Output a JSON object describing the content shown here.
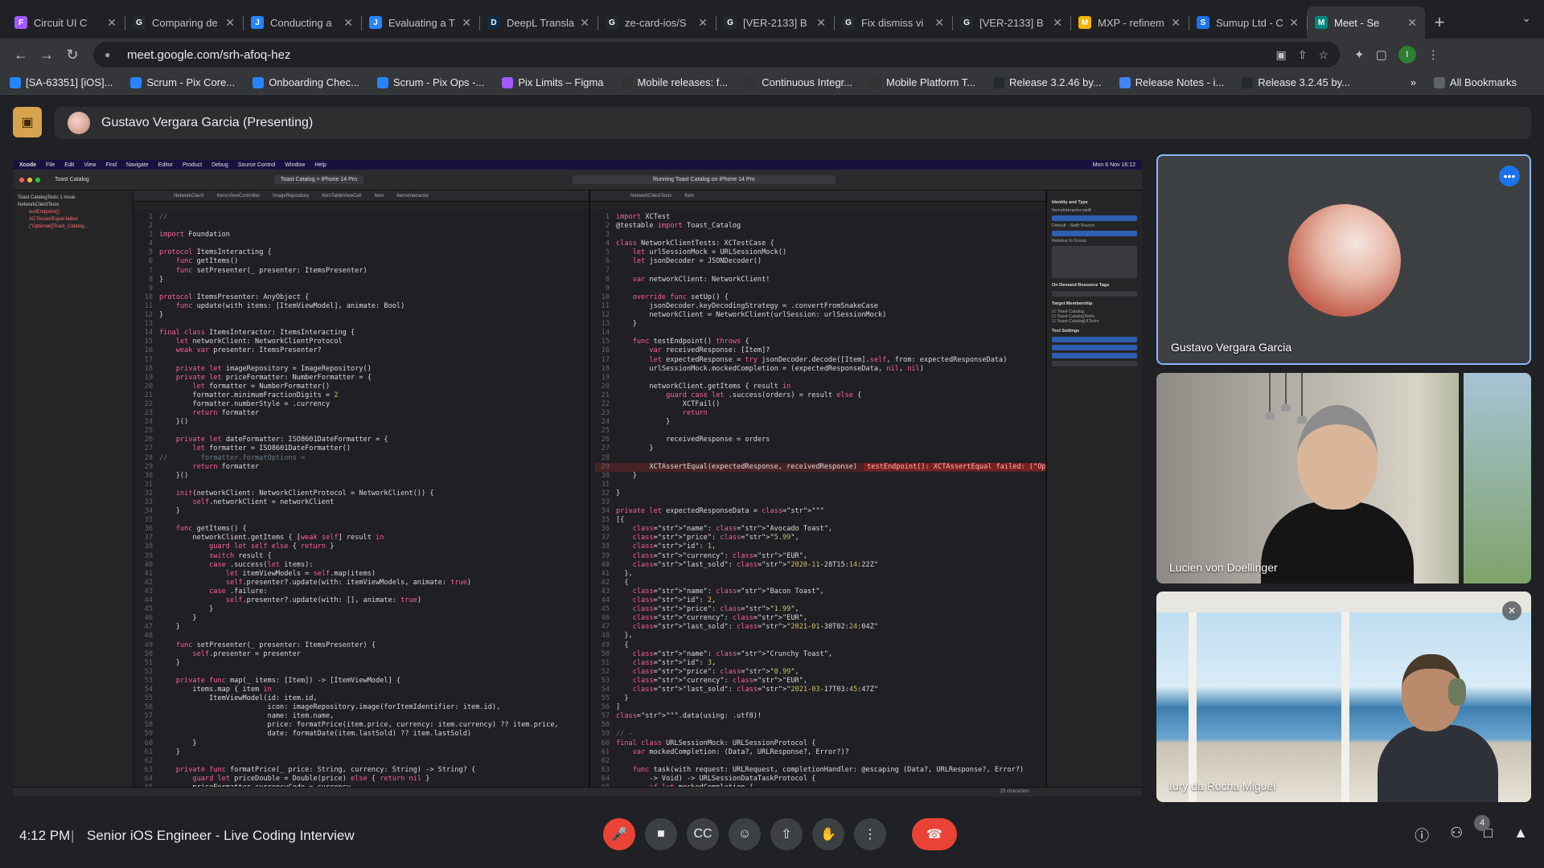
{
  "browser": {
    "tabs": [
      {
        "title": "Circuit UI C",
        "fav": "F",
        "color": "#a259ff"
      },
      {
        "title": "Comparing de",
        "fav": "G",
        "color": "#24292e"
      },
      {
        "title": "Conducting a",
        "fav": "J",
        "color": "#2684ff"
      },
      {
        "title": "Evaluating a T",
        "fav": "J",
        "color": "#2684ff"
      },
      {
        "title": "DeepL Transla",
        "fav": "D",
        "color": "#0f2b46"
      },
      {
        "title": "ze-card-ios/S",
        "fav": "G",
        "color": "#24292e"
      },
      {
        "title": "[VER-2133] B",
        "fav": "G",
        "color": "#24292e"
      },
      {
        "title": "Fix dismiss vi",
        "fav": "G",
        "color": "#24292e"
      },
      {
        "title": "[VER-2133] B",
        "fav": "G",
        "color": "#24292e"
      },
      {
        "title": "MXP - refinem",
        "fav": "M",
        "color": "#f4b400"
      },
      {
        "title": "Sumup Ltd - C",
        "fav": "S",
        "color": "#1a73e8"
      },
      {
        "title": "Meet - Se",
        "fav": "M",
        "color": "#00897b",
        "active": true
      }
    ],
    "url": "meet.google.com/srh-afoq-hez",
    "profile_initial": "I",
    "bookmarks": [
      {
        "label": "[SA-63351] [iOS]...",
        "color": "#2684ff"
      },
      {
        "label": "Scrum - Pix Core...",
        "color": "#2684ff"
      },
      {
        "label": "Onboarding Chec...",
        "color": "#2684ff"
      },
      {
        "label": "Scrum - Pix Ops -...",
        "color": "#2684ff"
      },
      {
        "label": "Pix Limits – Figma",
        "color": "#a259ff"
      },
      {
        "label": "Mobile releases: f...",
        "color": "#333333"
      },
      {
        "label": "Continuous Integr...",
        "color": "#333333"
      },
      {
        "label": "Mobile Platform T...",
        "color": "#333333"
      },
      {
        "label": "Release 3.2.46 by...",
        "color": "#24292e"
      },
      {
        "label": "Release Notes - i...",
        "color": "#4285f4"
      },
      {
        "label": "Release 3.2.45 by...",
        "color": "#24292e"
      }
    ],
    "all_bookmarks": "All Bookmarks",
    "more": "»"
  },
  "meet": {
    "presenting_label": "Gustavo Vergara Garcia (Presenting)",
    "participants": [
      {
        "name": "Gustavo Vergara Garcia"
      },
      {
        "name": "Lucien von Doellinger"
      },
      {
        "name": "Iury da Rocha Miguel"
      }
    ],
    "time": "4:12 PM",
    "separator": "|",
    "meeting_title": "Senior iOS Engineer - Live Coding Interview",
    "participant_count": "4"
  },
  "xcode": {
    "menubar": [
      "Xcode",
      "File",
      "Edit",
      "View",
      "Find",
      "Navigate",
      "Editor",
      "Product",
      "Debug",
      "Source Control",
      "Window",
      "Help"
    ],
    "datetime": "Mon 6 Nov 16:12",
    "project": "Toast Catalog",
    "scheme": "Toast Catalog > iPhone 14 Pro",
    "status": "Running Toast Catalog on iPhone 14 Pro",
    "navigator": [
      "Toast CatalogTests 1 issue",
      "NetworkClientTests",
      "testEndpoint():",
      "XCTAssertEqual failed:",
      "(\"Optional([Toast_Catalog..."
    ],
    "left_tabs": [
      "NetworkClient",
      "ItemsViewController",
      "ImageRepository",
      "ItemTableViewCell",
      "Item",
      "ItemsInteractor"
    ],
    "right_tabs": [
      "NetworkClientTests",
      "Item"
    ],
    "left_code": [
      "//",
      "",
      "import Foundation",
      "",
      "protocol ItemsInteracting {",
      "    func getItems()",
      "    func setPresenter(_ presenter: ItemsPresenter)",
      "}",
      "",
      "protocol ItemsPresenter: AnyObject {",
      "    func update(with items: [ItemViewModel], animate: Bool)",
      "}",
      "",
      "final class ItemsInteractor: ItemsInteracting {",
      "    let networkClient: NetworkClientProtocol",
      "    weak var presenter: ItemsPresenter?",
      "",
      "    private let imageRepository = ImageRepository()",
      "    private let priceFormatter: NumberFormatter = {",
      "        let formatter = NumberFormatter()",
      "        formatter.minimumFractionDigits = 2",
      "        formatter.numberStyle = .currency",
      "        return formatter",
      "    }()",
      "",
      "    private let dateFormatter: ISO8601DateFormatter = {",
      "        let formatter = ISO8601DateFormatter()",
      "//        formatter.formatOptions =",
      "        return formatter",
      "    }()",
      "",
      "    init(networkClient: NetworkClientProtocol = NetworkClient()) {",
      "        self.networkClient = networkClient",
      "    }",
      "",
      "    func getItems() {",
      "        networkClient.getItems { [weak self] result in",
      "            guard let self else { return }",
      "            switch result {",
      "            case .success(let items):",
      "                let itemViewModels = self.map(items)",
      "                self.presenter?.update(with: itemViewModels, animate: true)",
      "            case .failure:",
      "                self.presenter?.update(with: [], animate: true)",
      "            }",
      "        }",
      "    }",
      "",
      "    func setPresenter(_ presenter: ItemsPresenter) {",
      "        self.presenter = presenter",
      "    }",
      "",
      "    private func map(_ items: [Item]) -> [ItemViewModel] {",
      "        items.map { item in",
      "            ItemViewModel(id: item.id,",
      "                          icon: imageRepository.image(forItemIdentifier: item.id),",
      "                          name: item.name,",
      "                          price: formatPrice(item.price, currency: item.currency) ?? item.price,",
      "                          date: formatDate(item.lastSold) ?? item.lastSold)",
      "        }",
      "    }",
      "",
      "    private func formatPrice(_ price: String, currency: String) -> String? {",
      "        guard let priceDouble = Double(price) else { return nil }",
      "        priceFormatter.currencyCode = currency"
    ],
    "right_code": [
      "import XCTest",
      "@testable import Toast_Catalog",
      "",
      "class NetworkClientTests: XCTestCase {",
      "    let urlSessionMock = URLSessionMock()",
      "    let jsonDecoder = JSONDecoder()",
      "",
      "    var networkClient: NetworkClient!",
      "",
      "    override func setUp() {",
      "        jsonDecoder.keyDecodingStrategy = .convertFromSnakeCase",
      "        networkClient = NetworkClient(urlSession: urlSessionMock)",
      "    }",
      "",
      "    func testEndpoint() throws {",
      "        var receivedResponse: [Item]?",
      "        let expectedResponse = try jsonDecoder.decode([Item].self, from: expectedResponseData)",
      "        urlSessionMock.mockedCompletion = (expectedResponseData, nil, nil)",
      "",
      "        networkClient.getItems { result in",
      "            guard case let .success(orders) = result else {",
      "                XCTFail()",
      "                return",
      "            }",
      "",
      "            receivedResponse = orders",
      "        }",
      "",
      "        XCTAssertEqual(expectedResponse, receivedResponse)",
      "    }",
      "",
      "}",
      "",
      "private let expectedResponseData = \"\"\"",
      "[{",
      "    \"name\": \"Avocado Toast\",",
      "    \"price\": \"5.99\",",
      "    \"id\": 1,",
      "    \"currency\": \"EUR\",",
      "    \"last_sold\": \"2020-11-28T15:14:22Z\"",
      "  },",
      "  {",
      "    \"name\": \"Bacon Toast\",",
      "    \"id\": 2,",
      "    \"price\": \"1.99\",",
      "    \"currency\": \"EUR\",",
      "    \"last_sold\": \"2021-01-30T02:24:04Z\"",
      "  },",
      "  {",
      "    \"name\": \"Crunchy Toast\",",
      "    \"id\": 3,",
      "    \"price\": \"0.99\",",
      "    \"currency\": \"EUR\",",
      "    \"last_sold\": \"2021-03-17T03:45:47Z\"",
      "  }",
      "]",
      "\"\"\".data(using: .utf8)!",
      "",
      "// -",
      "final class URLSessionMock: URLSessionProtocol {",
      "    var mockedCompletion: (Data?, URLResponse?, Error?)?",
      "",
      "    func task(with request: URLRequest, completionHandler: @escaping (Data?, URLResponse?, Error?)",
      "        -> Void) -> URLSessionDataTaskProtocol {",
      "        if let mockedCompletion {"
    ],
    "error_annotation": "testEndpoint(): XCTAssertEqual failed: (\"Option...",
    "inspector": {
      "title": "Identity and Type",
      "name": "ItemsInteractor.swift",
      "type": "Default - Swift Source",
      "location": "Relative to Group",
      "demand": "On Demand Resource Tags",
      "target": "Target Membership",
      "targets": [
        "Toast Catalog",
        "Toast CatalogTests",
        "Toast CatalogUITests"
      ],
      "text_settings": "Text Settings",
      "char_count": "23 characters"
    }
  }
}
